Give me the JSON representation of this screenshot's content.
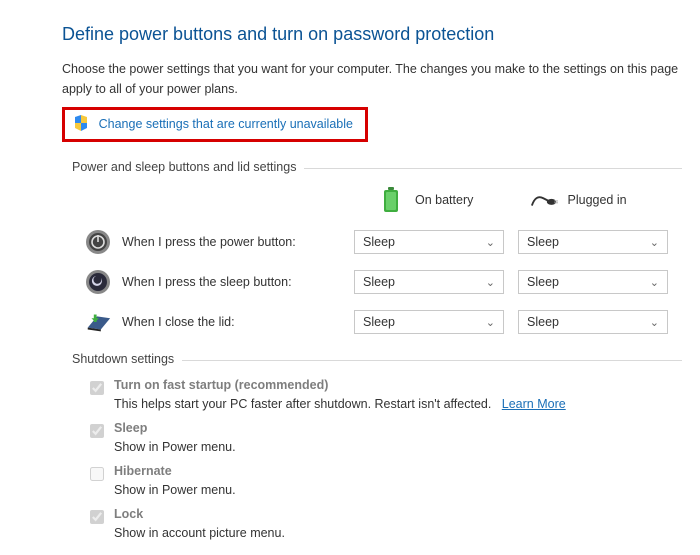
{
  "title": "Define power buttons and turn on password protection",
  "description": "Choose the power settings that you want for your computer. The changes you make to the settings on this page apply to all of your power plans.",
  "change_link": "Change settings that are currently unavailable",
  "section_power_sleep": "Power and sleep buttons and lid settings",
  "headers": {
    "battery": "On battery",
    "plugged": "Plugged in"
  },
  "rows": {
    "power_button": {
      "label": "When I press the power button:",
      "batt": "Sleep",
      "plug": "Sleep"
    },
    "sleep_button": {
      "label": "When I press the sleep button:",
      "batt": "Sleep",
      "plug": "Sleep"
    },
    "lid_close": {
      "label": "When I close the lid:",
      "batt": "Sleep",
      "plug": "Sleep"
    }
  },
  "section_shutdown": "Shutdown settings",
  "shutdown": {
    "fast_startup": {
      "title": "Turn on fast startup (recommended)",
      "desc": "This helps start your PC faster after shutdown. Restart isn't affected.",
      "learn_more": "Learn More"
    },
    "sleep": {
      "title": "Sleep",
      "desc": "Show in Power menu."
    },
    "hibernate": {
      "title": "Hibernate",
      "desc": "Show in Power menu."
    },
    "lock": {
      "title": "Lock",
      "desc": "Show in account picture menu."
    }
  }
}
